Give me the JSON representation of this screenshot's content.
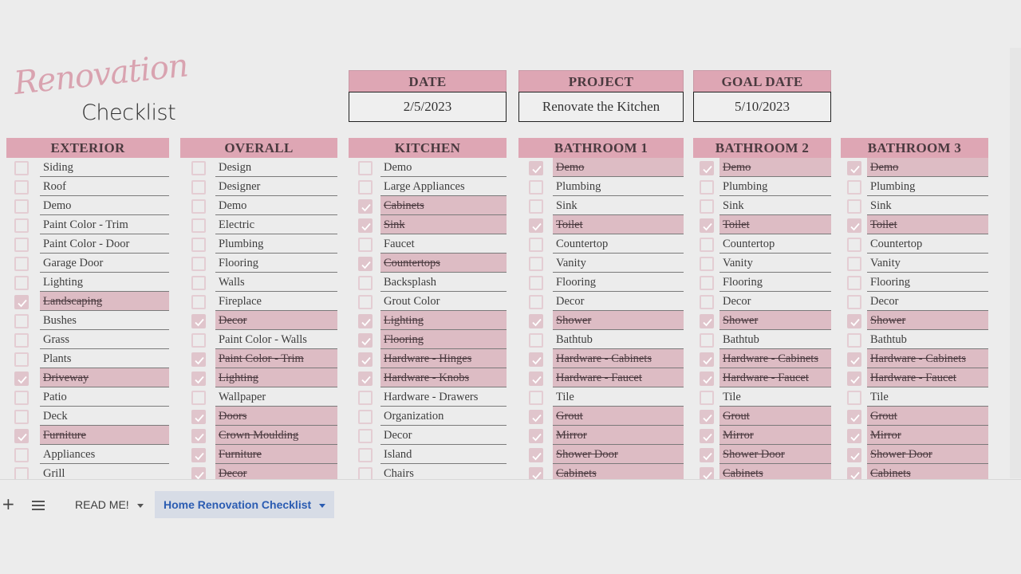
{
  "logo": {
    "script": "Renovation",
    "plain": "Checklist"
  },
  "info": {
    "date": {
      "label": "DATE",
      "value": "2/5/2023"
    },
    "project": {
      "label": "PROJECT",
      "value": "Renovate the Kitchen"
    },
    "goal_date": {
      "label": "GOAL DATE",
      "value": "5/10/2023"
    }
  },
  "columns": [
    {
      "title": "EXTERIOR",
      "items": [
        {
          "label": "Siding",
          "done": false
        },
        {
          "label": "Roof",
          "done": false
        },
        {
          "label": "Demo",
          "done": false
        },
        {
          "label": "Paint Color - Trim",
          "done": false
        },
        {
          "label": "Paint Color - Door",
          "done": false
        },
        {
          "label": "Garage Door",
          "done": false
        },
        {
          "label": "Lighting",
          "done": false
        },
        {
          "label": "Landscaping",
          "done": true
        },
        {
          "label": "Bushes",
          "done": false
        },
        {
          "label": "Grass",
          "done": false
        },
        {
          "label": "Plants",
          "done": false
        },
        {
          "label": "Driveway",
          "done": true
        },
        {
          "label": "Patio",
          "done": false
        },
        {
          "label": "Deck",
          "done": false
        },
        {
          "label": "Furniture",
          "done": true
        },
        {
          "label": "Appliances",
          "done": false
        },
        {
          "label": "Grill",
          "done": false
        }
      ]
    },
    {
      "title": "OVERALL",
      "items": [
        {
          "label": "Design",
          "done": false
        },
        {
          "label": "Designer",
          "done": false
        },
        {
          "label": "Demo",
          "done": false
        },
        {
          "label": "Electric",
          "done": false
        },
        {
          "label": "Plumbing",
          "done": false
        },
        {
          "label": "Flooring",
          "done": false
        },
        {
          "label": "Walls",
          "done": false
        },
        {
          "label": "Fireplace",
          "done": false
        },
        {
          "label": "Decor",
          "done": true
        },
        {
          "label": "Paint Color - Walls",
          "done": false
        },
        {
          "label": "Paint Color - Trim",
          "done": true
        },
        {
          "label": "Lighting",
          "done": true
        },
        {
          "label": "Wallpaper",
          "done": false
        },
        {
          "label": "Doors",
          "done": true
        },
        {
          "label": "Crown Moulding",
          "done": true
        },
        {
          "label": "Furniture",
          "done": true
        },
        {
          "label": "Decor",
          "done": true
        }
      ]
    },
    {
      "title": "KITCHEN",
      "items": [
        {
          "label": "Demo",
          "done": false
        },
        {
          "label": "Large Appliances",
          "done": false
        },
        {
          "label": "Cabinets",
          "done": true
        },
        {
          "label": "Sink",
          "done": true
        },
        {
          "label": "Faucet",
          "done": false
        },
        {
          "label": "Countertops",
          "done": true
        },
        {
          "label": "Backsplash",
          "done": false
        },
        {
          "label": "Grout Color",
          "done": false
        },
        {
          "label": "Lighting",
          "done": true
        },
        {
          "label": "Flooring",
          "done": true
        },
        {
          "label": "Hardware - Hinges",
          "done": true
        },
        {
          "label": "Hardware - Knobs",
          "done": true
        },
        {
          "label": "Hardware - Drawers",
          "done": false
        },
        {
          "label": "Organization",
          "done": false
        },
        {
          "label": "Decor",
          "done": false
        },
        {
          "label": "Island",
          "done": false
        },
        {
          "label": "Chairs",
          "done": false
        }
      ]
    },
    {
      "title": "BATHROOM 1",
      "items": [
        {
          "label": "Demo",
          "done": true
        },
        {
          "label": "Plumbing",
          "done": false
        },
        {
          "label": "Sink",
          "done": false
        },
        {
          "label": "Toilet",
          "done": true
        },
        {
          "label": "Countertop",
          "done": false
        },
        {
          "label": "Vanity",
          "done": false
        },
        {
          "label": "Flooring",
          "done": false
        },
        {
          "label": "Decor",
          "done": false
        },
        {
          "label": "Shower",
          "done": true
        },
        {
          "label": "Bathtub",
          "done": false
        },
        {
          "label": "Hardware - Cabinets",
          "done": true
        },
        {
          "label": "Hardware - Faucet",
          "done": true
        },
        {
          "label": "Tile",
          "done": false
        },
        {
          "label": "Grout",
          "done": true
        },
        {
          "label": "Mirror",
          "done": true
        },
        {
          "label": "Shower Door",
          "done": true
        },
        {
          "label": "Cabinets",
          "done": true
        }
      ]
    },
    {
      "title": "BATHROOM 2",
      "items": [
        {
          "label": "Demo",
          "done": true
        },
        {
          "label": "Plumbing",
          "done": false
        },
        {
          "label": "Sink",
          "done": false
        },
        {
          "label": "Toilet",
          "done": true
        },
        {
          "label": "Countertop",
          "done": false
        },
        {
          "label": "Vanity",
          "done": false
        },
        {
          "label": "Flooring",
          "done": false
        },
        {
          "label": "Decor",
          "done": false
        },
        {
          "label": "Shower",
          "done": true
        },
        {
          "label": "Bathtub",
          "done": false
        },
        {
          "label": "Hardware - Cabinets",
          "done": true
        },
        {
          "label": "Hardware - Faucet",
          "done": true
        },
        {
          "label": "Tile",
          "done": false
        },
        {
          "label": "Grout",
          "done": true
        },
        {
          "label": "Mirror",
          "done": true
        },
        {
          "label": "Shower Door",
          "done": true
        },
        {
          "label": "Cabinets",
          "done": true
        }
      ]
    },
    {
      "title": "BATHROOM 3",
      "items": [
        {
          "label": "Demo",
          "done": true
        },
        {
          "label": "Plumbing",
          "done": false
        },
        {
          "label": "Sink",
          "done": false
        },
        {
          "label": "Toilet",
          "done": true
        },
        {
          "label": "Countertop",
          "done": false
        },
        {
          "label": "Vanity",
          "done": false
        },
        {
          "label": "Flooring",
          "done": false
        },
        {
          "label": "Decor",
          "done": false
        },
        {
          "label": "Shower",
          "done": true
        },
        {
          "label": "Bathtub",
          "done": false
        },
        {
          "label": "Hardware - Cabinets",
          "done": true
        },
        {
          "label": "Hardware - Faucet",
          "done": true
        },
        {
          "label": "Tile",
          "done": false
        },
        {
          "label": "Grout",
          "done": true
        },
        {
          "label": "Mirror",
          "done": true
        },
        {
          "label": "Shower Door",
          "done": true
        },
        {
          "label": "Cabinets",
          "done": true
        }
      ]
    }
  ],
  "sheet_tabs": {
    "add_icon": "plus-icon",
    "menu_icon": "hamburger-icon",
    "tabs": [
      {
        "label": "READ ME!",
        "active": false
      },
      {
        "label": "Home Renovation Checklist",
        "active": true
      }
    ]
  },
  "colors": {
    "header_pink": "#dea6b4",
    "done_row": "#ddbcc4",
    "active_tab_text": "#2b5cb2"
  }
}
